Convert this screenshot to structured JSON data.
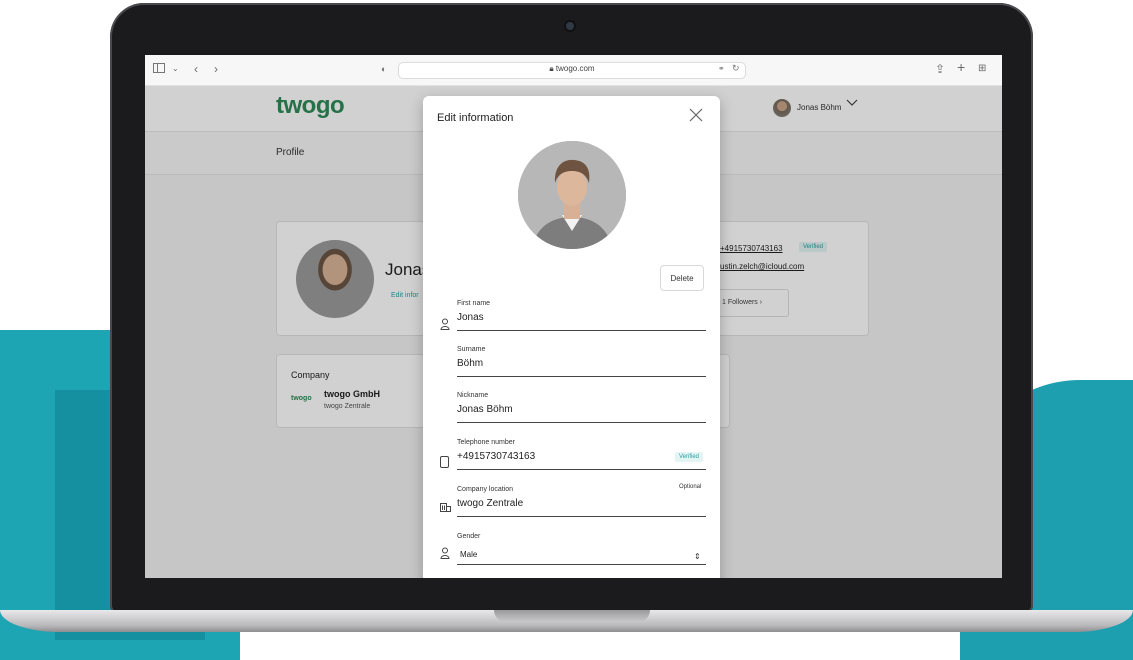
{
  "browser": {
    "url": "twogo.com",
    "nav_back_icon": "chevron-left-icon",
    "nav_forward_icon": "chevron-right-icon"
  },
  "site": {
    "logo": "twogo",
    "user_name": "Jonas Böhm",
    "page_title": "Profile"
  },
  "profile_card": {
    "name": "Jonas",
    "edit_link": "Edit infor",
    "phone": "+4915730743163",
    "verified": "Verified",
    "email": "ustin.zelch@icloud.com",
    "followers": "1 Followers"
  },
  "company_card": {
    "title": "Company",
    "logo": "twogo",
    "name": "twogo GmbH",
    "location": "twogo Zentrale"
  },
  "modal": {
    "title": "Edit information",
    "delete_label": "Delete",
    "fields": {
      "first_name": {
        "label": "First name",
        "value": "Jonas"
      },
      "surname": {
        "label": "Surname",
        "value": "Böhm"
      },
      "nickname": {
        "label": "Nickname",
        "value": "Jonas Böhm"
      },
      "telephone": {
        "label": "Telephone number",
        "value": "+4915730743163",
        "badge": "Verified"
      },
      "company_location": {
        "label": "Company location",
        "value": "twogo Zentrale",
        "note": "Optional"
      },
      "gender": {
        "label": "Gender",
        "value": "Male"
      }
    }
  },
  "colors": {
    "brand_green": "#2f8a57",
    "accent_teal": "#1ea5b3"
  }
}
